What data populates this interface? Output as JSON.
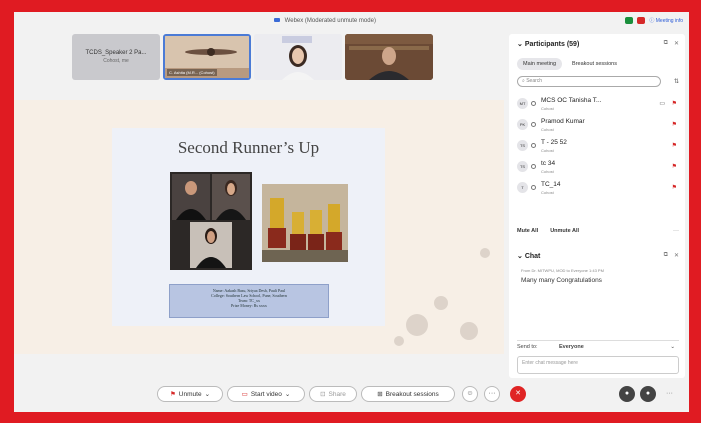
{
  "meeting": {
    "top_title": "Webex (Moderated unmute mode)",
    "meeting_info": "Meeting info"
  },
  "thumbnails": [
    {
      "name": "TCDS_Speaker 2 Pa...",
      "sub": "Cohost, me"
    },
    {
      "name": "C. Ashita (M.R... (Cohost)"
    },
    {
      "name": ""
    },
    {
      "name": ""
    }
  ],
  "slide": {
    "title": "Second Runner’s Up",
    "caption": [
      "Name: Aakash Basu, Sriyaa Desh, Pauli Paul",
      "College: Southern Law School, Pune, Southern",
      "Team: TC_xx",
      "Prize Money: Rs xxxx"
    ]
  },
  "participants": {
    "title": "Participants (59)",
    "tabs": [
      "Main meeting",
      "Breakout sessions"
    ],
    "search_placeholder": "Search",
    "rows": [
      {
        "initials": "MT",
        "name": "MCS OC Tanisha T...",
        "role": "Cohost"
      },
      {
        "initials": "PK",
        "name": "Pramod Kumar",
        "role": "Cohost"
      },
      {
        "initials": "TS",
        "name": "T - 25 52",
        "role": "Cohost"
      },
      {
        "initials": "TS",
        "name": "tc 34",
        "role": "Cohost"
      },
      {
        "initials": "T",
        "name": "TC_14",
        "role": "Cohost"
      }
    ],
    "mute_all": "Mute All",
    "unmute_all": "Unmute All"
  },
  "chat": {
    "title": "Chat",
    "from_line": "From Dr. MITWPU, MOD to Everyone   1:43 PM",
    "message": "Many many Congratulations",
    "send_to_label": "Send to:",
    "send_to_value": "Everyone",
    "input_placeholder": "Enter chat message here"
  },
  "controls": {
    "unmute": "Unmute",
    "start_video": "Start video",
    "share": "Share",
    "breakout": "Breakout sessions"
  },
  "colors": {
    "border_red": "#e01b22",
    "end_red": "#e02424",
    "accent_blue": "#3a6ad6"
  }
}
